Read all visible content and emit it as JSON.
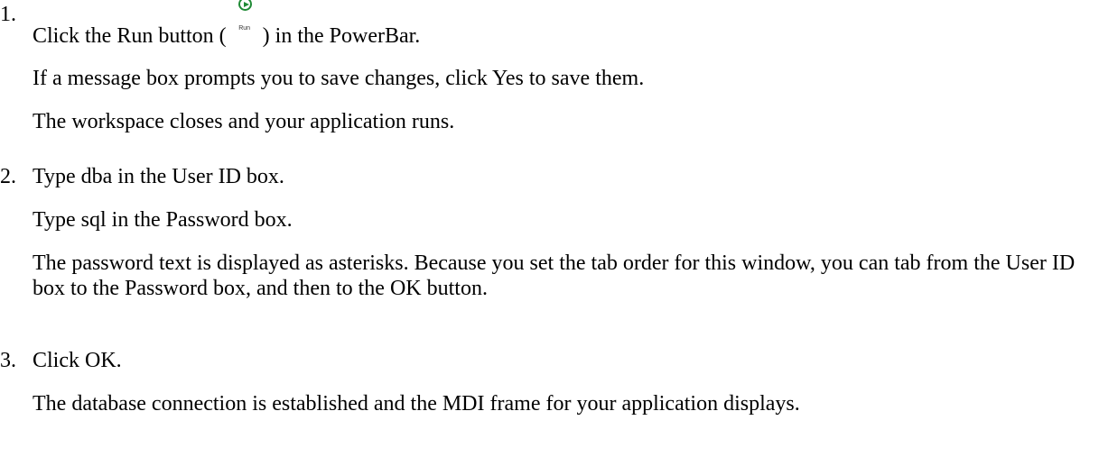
{
  "steps": [
    {
      "number": "1.",
      "lines": [
        {
          "before": "Click the Run button (",
          "icon": "run-play-icon",
          "icon_label": "Run",
          "after": ") in the PowerBar."
        },
        "If a message box prompts you to save changes, click Yes to save them.",
        "The workspace closes and your application runs."
      ]
    },
    {
      "number": "2.",
      "lines": [
        "Type dba in the User ID box.",
        "Type sql in the Password box.",
        "The password text is displayed as asterisks. Because you set the tab order for this window, you can tab from the User ID box to the Password box, and then to the OK button."
      ]
    },
    {
      "number": "3.",
      "lines": [
        "Click OK.",
        "The database connection is established and the MDI frame for your application displays."
      ]
    }
  ],
  "colors": {
    "icon_green": "#1f8a35",
    "text": "#000000",
    "background": "#ffffff"
  }
}
